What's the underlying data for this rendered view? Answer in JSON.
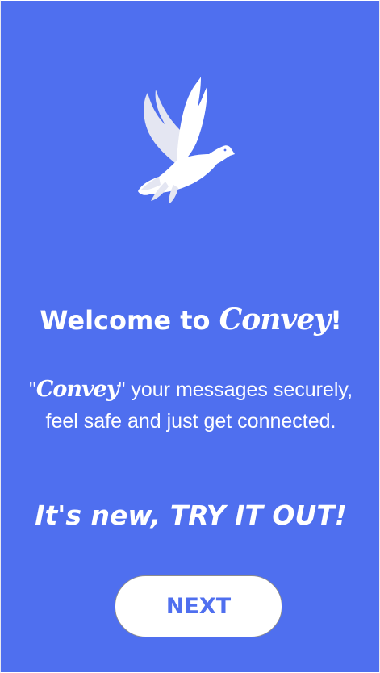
{
  "logo": {
    "icon": "dove-icon"
  },
  "welcome": {
    "prefix": "Welcome to ",
    "brand": "Convey",
    "suffix": "!"
  },
  "tagline": {
    "open_quote": "\"",
    "brand": "Convey",
    "line1_rest": "\" your messages securely,",
    "line2": "feel safe and just get connected."
  },
  "tryout": "It's new, TRY IT OUT!",
  "next_button": {
    "label": "NEXT"
  },
  "colors": {
    "background": "#4f6fef",
    "text": "#ffffff",
    "button_bg": "#ffffff",
    "button_text": "#4f6fef"
  }
}
